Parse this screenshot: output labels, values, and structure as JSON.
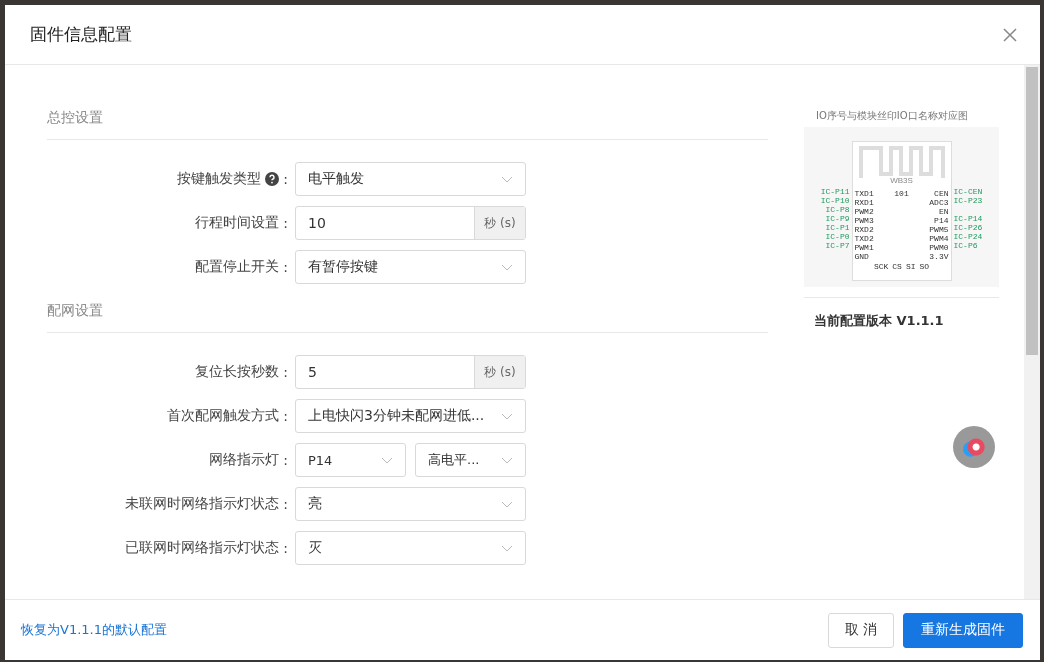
{
  "dialog": {
    "title": "固件信息配置"
  },
  "sections": [
    {
      "title": "总控设置",
      "fields": [
        {
          "label": "按键触发类型",
          "kind": "select",
          "help": true,
          "colon": ":",
          "value": "电平触发"
        },
        {
          "label": "行程时间设置",
          "kind": "unit",
          "help": false,
          "colon": ":",
          "value": "10",
          "unit": "秒 (s)"
        },
        {
          "label": "配置停止开关",
          "kind": "select",
          "help": false,
          "colon": ":",
          "value": "有暂停按键"
        }
      ]
    },
    {
      "title": "配网设置",
      "fields": [
        {
          "label": "复位长按秒数",
          "kind": "unit",
          "help": false,
          "colon": ":",
          "value": "5",
          "unit": "秒 (s)"
        },
        {
          "label": "首次配网触发方式",
          "kind": "select",
          "help": false,
          "colon": ":",
          "value": "上电快闪3分钟未配网进低..."
        },
        {
          "label": "网络指示灯",
          "kind": "pair",
          "help": false,
          "colon": ":",
          "value": "P14",
          "value_2": "高电平..."
        },
        {
          "label": "未联网时网络指示灯状态",
          "kind": "select",
          "help": false,
          "colon": ":",
          "value": "亮"
        },
        {
          "label": "已联网时网络指示灯状态",
          "kind": "select",
          "help": false,
          "colon": ":",
          "value": "灭"
        }
      ]
    }
  ],
  "diagram": {
    "caption": "IO序号与模块丝印IO口名称对应图",
    "module": "WB3S",
    "center": "101",
    "left_pins": [
      {
        "ic": "IC-P11",
        "pin": "TXD1"
      },
      {
        "ic": "IC-P10",
        "pin": "RXD1"
      },
      {
        "ic": "IC-P8",
        "pin": "PWM2"
      },
      {
        "ic": "IC-P9",
        "pin": "PWM3"
      },
      {
        "ic": "IC-P1",
        "pin": "RXD2"
      },
      {
        "ic": "IC-P0",
        "pin": "TXD2"
      },
      {
        "ic": "IC-P7",
        "pin": "PWM1"
      },
      {
        "pin": "GND"
      }
    ],
    "right_pins": [
      {
        "ic": "IC-CEN",
        "pin": "CEN"
      },
      {
        "ic": "IC-P23",
        "pin": "ADC3"
      },
      {
        "pin": "EN"
      },
      {
        "ic": "IC-P14",
        "pin": "P14"
      },
      {
        "ic": "IC-P26",
        "pin": "PWM5"
      },
      {
        "ic": "IC-P24",
        "pin": "PWM4"
      },
      {
        "ic": "IC-P6",
        "pin": "PWM0"
      },
      {
        "pin": "3.3V"
      }
    ],
    "bottom_pins": [
      "SCK",
      "CS",
      "SI",
      "SO"
    ]
  },
  "version": "当前配置版本 V1.1.1",
  "footer": {
    "link": "恢复为V1.1.1的默认配置",
    "buttons": [
      {
        "label": "取 消",
        "primary": false
      },
      {
        "label": "重新生成固件",
        "primary": true
      }
    ]
  }
}
